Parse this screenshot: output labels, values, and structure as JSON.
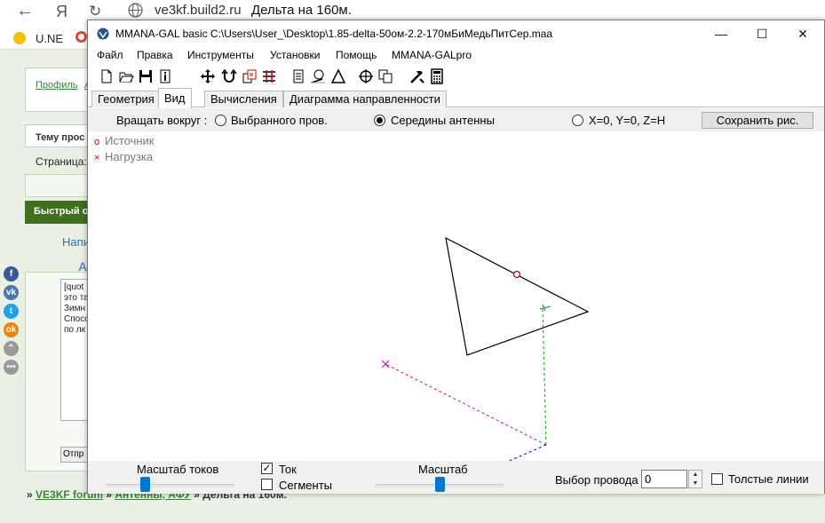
{
  "browser": {
    "back_icon": "arrow-left-icon",
    "yandex_logo": "Я",
    "host": "ve3kf.build2.ru",
    "page_title": "Дельта на 160м.",
    "bookmark_label": "U.NE"
  },
  "forum": {
    "profile_link": "Профиль",
    "profile_link_extra": "А",
    "topic_label": "Тему прос",
    "page_label": "Страница:",
    "quick_reply_label": "Быстрый о",
    "compose_label": "Напи",
    "textarea_lines": [
      "[quot",
      "это та",
      "Зимн",
      "Спосо",
      "по лк"
    ],
    "send_button": "Отпр",
    "breadcrumb": {
      "lead": "» ",
      "home": "VE3KF forum",
      "sep1": " » ",
      "section": "Антенны, АФУ",
      "sep2": " » ",
      "current": "Дельта на 160м."
    }
  },
  "app": {
    "title": "MMANA-GAL basic C:\\Users\\User_\\Desktop\\1.85-delta-50ом-2.2-170мБиМедьПитСер.maa",
    "window_buttons": {
      "minimize": "—",
      "maximize": "☐",
      "close": "✕"
    },
    "menu": [
      "Файл",
      "Правка",
      "Инструменты",
      "Установки",
      "Помощь",
      "MMANA-GALpro"
    ],
    "tabs": [
      "Геометрия",
      "Вид",
      "Вычисления",
      "Диаграмма направленности"
    ],
    "active_tab": "Вид",
    "rotate": {
      "label": "Вращать вокруг :",
      "options": [
        "Выбранного пров.",
        "Середины антенны",
        "X=0, Y=0, Z=H"
      ],
      "selected": "Середины антенны",
      "save_button": "Сохранить рис."
    },
    "legend": {
      "source_mark": "o",
      "source_label": "Источник",
      "load_mark": "×",
      "load_label": "Нагрузка"
    },
    "bottom": {
      "current_scale_label": "Масштаб токов",
      "current_scale_value": 0.3,
      "current_checkbox_label": "Ток",
      "current_checked": true,
      "segments_checkbox_label": "Сегменты",
      "segments_checked": false,
      "scale_label": "Масштаб",
      "scale_value": 0.5,
      "wire_select_label": "Выбор провода",
      "wire_select_value": "0",
      "thick_lines_label": "Толстые линии",
      "thick_lines_checked": false
    },
    "colors": {
      "wire": "#000000",
      "axis_x": "#c000c0",
      "axis_y": "#0000c0",
      "axis_z": "#00a000",
      "source": "#c00000",
      "accent": "#0078d7"
    }
  }
}
